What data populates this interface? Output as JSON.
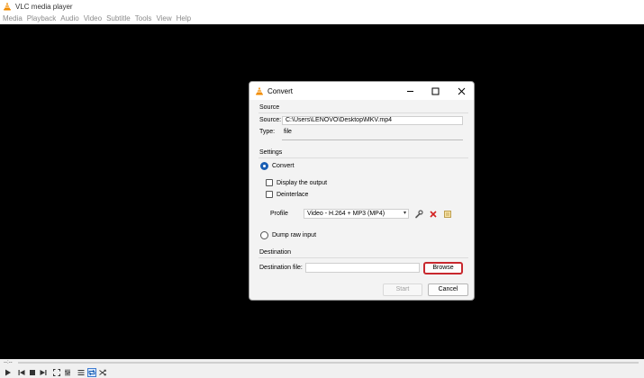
{
  "app": {
    "title": "VLC media player",
    "menu": [
      "Media",
      "Playback",
      "Audio",
      "Video",
      "Subtitle",
      "Tools",
      "View",
      "Help"
    ]
  },
  "player": {
    "time": "--:--",
    "controls": [
      "play-icon",
      "previous-icon",
      "stop-icon",
      "next-icon",
      "fullscreen-icon",
      "extended-settings-icon",
      "playlist-icon",
      "loop-icon",
      "shuffle-icon"
    ]
  },
  "dialog": {
    "title": "Convert",
    "source": {
      "section": "Source",
      "source_label": "Source:",
      "source_value": "C:\\Users\\LENOVO\\Desktop\\MKV.mp4",
      "type_label": "Type:",
      "type_value": "file"
    },
    "settings": {
      "section": "Settings",
      "convert_label": "Convert",
      "display_output_label": "Display the output",
      "deinterlace_label": "Deinterlace",
      "profile_label": "Profile",
      "profile_value": "Video - H.264 + MP3 (MP4)",
      "dump_raw_label": "Dump raw input"
    },
    "destination": {
      "section": "Destination",
      "dest_label": "Destination file:",
      "dest_value": "",
      "browse_label": "Browse"
    },
    "buttons": {
      "start": "Start",
      "cancel": "Cancel"
    }
  },
  "colors": {
    "video_bg": "#000000",
    "highlight": "#c8282e",
    "vlc_orange": "#f28c00",
    "radio_blue": "#1a5fb4"
  }
}
